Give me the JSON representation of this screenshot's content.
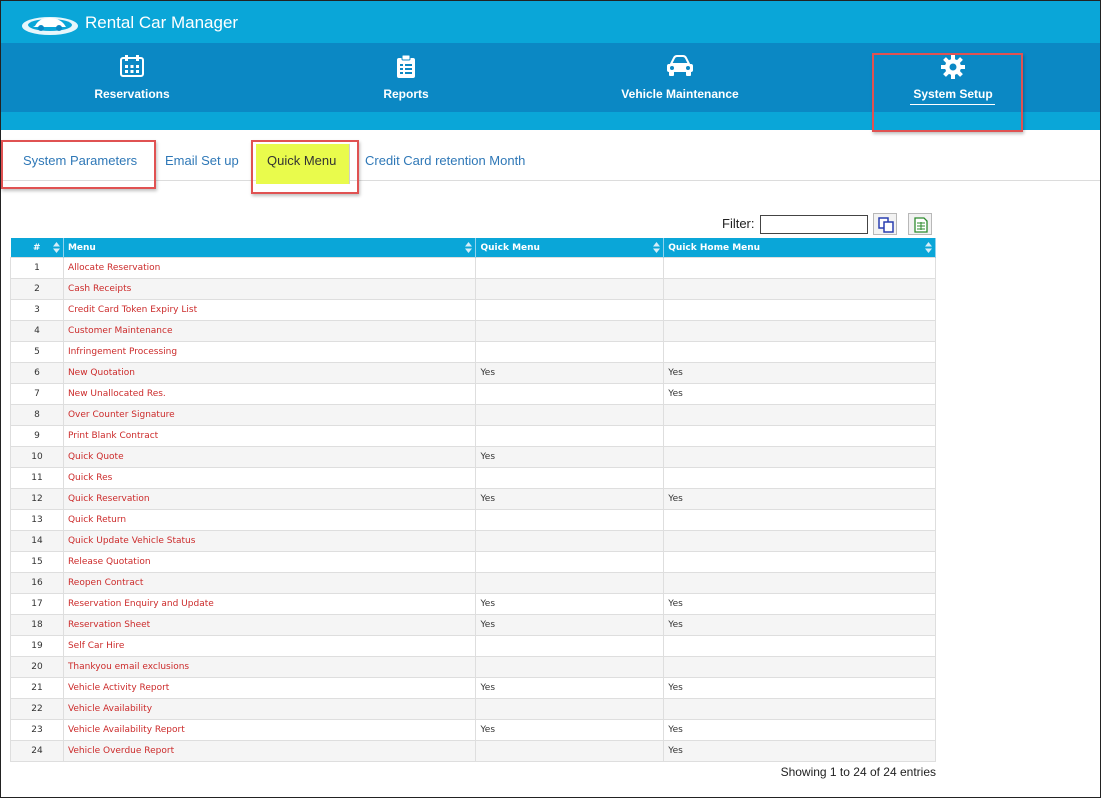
{
  "app": {
    "title": "Rental Car Manager"
  },
  "nav": {
    "items": [
      {
        "label": "Reservations",
        "icon": "calendar-icon"
      },
      {
        "label": "Reports",
        "icon": "clipboard-list-icon"
      },
      {
        "label": "Vehicle Maintenance",
        "icon": "car-icon"
      },
      {
        "label": "System Setup",
        "icon": "gear-icon",
        "active": true
      }
    ]
  },
  "tabs": [
    {
      "label": "System Parameters"
    },
    {
      "label": "Email Set up"
    },
    {
      "label": "Quick Menu",
      "active": true
    },
    {
      "label": "Credit Card retention Month"
    }
  ],
  "filter": {
    "label": "Filter:",
    "value": ""
  },
  "table": {
    "columns": [
      "#",
      "Menu",
      "Quick Menu",
      "Quick Home Menu"
    ],
    "rows": [
      [
        "1",
        "Allocate Reservation",
        "",
        ""
      ],
      [
        "2",
        "Cash Receipts",
        "",
        ""
      ],
      [
        "3",
        "Credit Card Token Expiry List",
        "",
        ""
      ],
      [
        "4",
        "Customer Maintenance",
        "",
        ""
      ],
      [
        "5",
        "Infringement Processing",
        "",
        ""
      ],
      [
        "6",
        "New Quotation",
        "Yes",
        "Yes"
      ],
      [
        "7",
        "New Unallocated Res.",
        "",
        "Yes"
      ],
      [
        "8",
        "Over Counter Signature",
        "",
        ""
      ],
      [
        "9",
        "Print Blank Contract",
        "",
        ""
      ],
      [
        "10",
        "Quick Quote",
        "Yes",
        ""
      ],
      [
        "11",
        "Quick Res",
        "",
        ""
      ],
      [
        "12",
        "Quick Reservation",
        "Yes",
        "Yes"
      ],
      [
        "13",
        "Quick Return",
        "",
        ""
      ],
      [
        "14",
        "Quick Update Vehicle Status",
        "",
        ""
      ],
      [
        "15",
        "Release Quotation",
        "",
        ""
      ],
      [
        "16",
        "Reopen Contract",
        "",
        ""
      ],
      [
        "17",
        "Reservation Enquiry and Update",
        "Yes",
        "Yes"
      ],
      [
        "18",
        "Reservation Sheet",
        "Yes",
        "Yes"
      ],
      [
        "19",
        "Self Car Hire",
        "",
        ""
      ],
      [
        "20",
        "Thankyou email exclusions",
        "",
        ""
      ],
      [
        "21",
        "Vehicle Activity Report",
        "Yes",
        "Yes"
      ],
      [
        "22",
        "Vehicle Availability",
        "",
        ""
      ],
      [
        "23",
        "Vehicle Availability Report",
        "Yes",
        "Yes"
      ],
      [
        "24",
        "Vehicle Overdue Report",
        "",
        "Yes"
      ]
    ]
  },
  "summary": "Showing 1 to 24 of 24 entries",
  "colors": {
    "header": "#0aa6d8",
    "nav": "#0b88c4",
    "highlight": "#e9fb4c",
    "annotation": "#e05252",
    "menu_link": "#cc2b2b"
  }
}
